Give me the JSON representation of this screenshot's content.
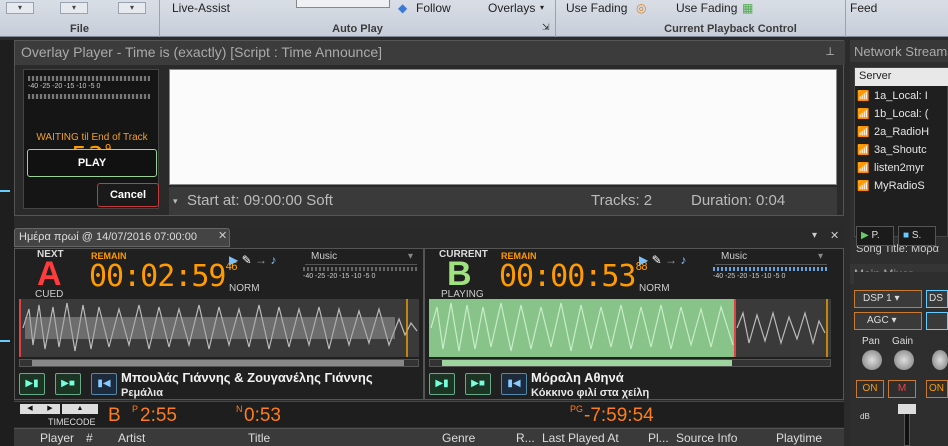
{
  "ribbon": {
    "file_label": "File",
    "live_assist": "Live-Assist",
    "auto_play_label": "Auto Play",
    "follow": "Follow",
    "overlays": "Overlays",
    "use_fading_1": "Use Fading",
    "use_fading_2": "Use Fading",
    "playback_label": "Current Playback Control",
    "feed": "Feed"
  },
  "overlay": {
    "title": "Overlay Player - Time is (exactly) [Script : Time Announce]",
    "meter_scale": "-40  -25 -20   -15    -10    -5    0",
    "waiting": "WAITING til End of Track",
    "countdown": "53",
    "countdown_frac": "9",
    "play": "PLAY",
    "cancel": "Cancel",
    "start_at": "Start at: 09:00:00  Soft",
    "tracks": "Tracks: 2",
    "duration": "Duration: 0:04"
  },
  "tab": {
    "label": "Ημέρα πρωί @ 14/07/2016 07:00:00"
  },
  "deck_a": {
    "role": "NEXT",
    "letter": "A",
    "state": "CUED",
    "remain": "REMAIN",
    "time": "00:02:59",
    "frac": "46",
    "category": "Music",
    "norm": "NORM",
    "scale": "-40   -25  -20   -15   -10    -5    0",
    "artist": "Μπουλάς Γιάννης & Ζουγανέλης Γιάννης",
    "title": "Ρεμάλια",
    "color": "#ff3b3b"
  },
  "deck_b": {
    "role": "CURRENT",
    "letter": "B",
    "state": "PLAYING",
    "remain": "REMAIN",
    "time": "00:00:53",
    "frac": "88",
    "category": "Music",
    "norm": "NORM",
    "scale": "-40   -25  -20   -15   -10    -5    0",
    "artist": "Μόραλη Αθηνά",
    "title": "Κόκκινο φιλί στα χείλη",
    "color": "#9ee37d"
  },
  "timecode": {
    "label": "TIMECODE",
    "deck": "B",
    "p_sup": "P",
    "p_val": "2:55",
    "n_sup": "N",
    "n_val": "0:53",
    "pg_sup": "PG",
    "pg_val": "-7:59:54"
  },
  "columns": [
    "Player",
    "#",
    "Artist",
    "Title",
    "Genre",
    "R...",
    "Last Played At",
    "Pl...",
    "Source Info",
    "Playtime"
  ],
  "right_panel": {
    "network_streams": "Network Streams",
    "server_header": "Server",
    "servers": [
      "1a_Local: I",
      "1b_Local: (",
      "2a_RadioH",
      "3a_Shoutc",
      "listen2myr",
      "MyRadioS"
    ],
    "song_title": "Song Title: Μόρα",
    "btn_p": "P.",
    "btn_s": "S.",
    "main_mixer": "Main Mixer",
    "dsp": "DSP 1",
    "dsp2": "DS",
    "agc": "AGC",
    "pan": "Pan",
    "gain": "Gain",
    "on": "ON",
    "m": "M",
    "db": "dB"
  }
}
